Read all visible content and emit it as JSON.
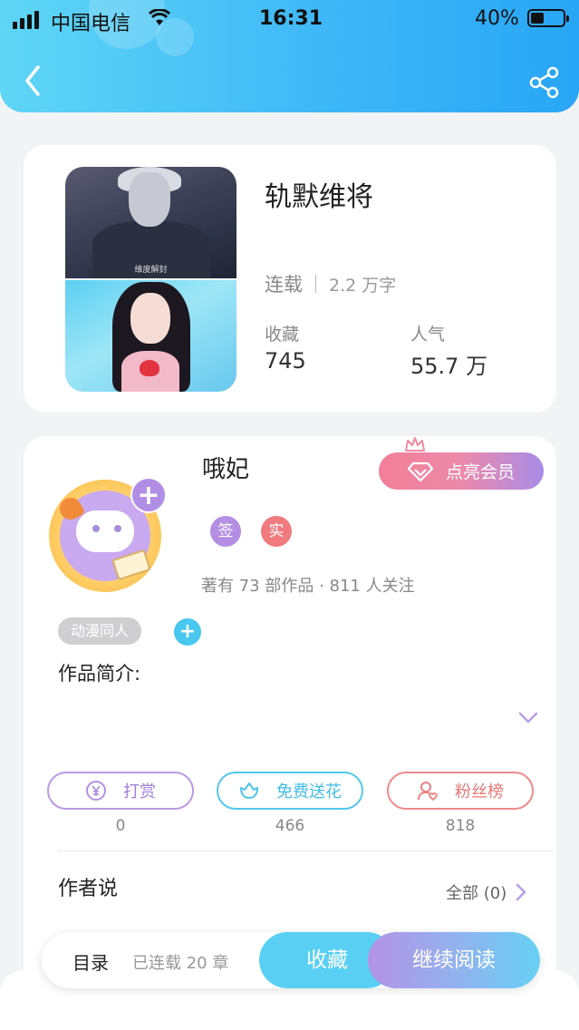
{
  "status_bar": {
    "carrier": "中国电信",
    "time": "16:31",
    "battery": "40%"
  },
  "header": {
    "back_icon": "chevron-left-icon",
    "share_icon": "share-icon"
  },
  "book": {
    "title": "轨默维将",
    "cover_caption": "维度解封",
    "status": "连载",
    "word_count": "2.2 万字",
    "favorites_label": "收藏",
    "favorites_value": "745",
    "popularity_label": "人气",
    "popularity_value": "55.7 万"
  },
  "author": {
    "name": "哦妃",
    "vip_button": "点亮会员",
    "badge_sign": "签",
    "badge_real": "实",
    "stats": "著有 73 部作品 · 811 人关注",
    "genre_tag": "动漫同人",
    "intro_label": "作品简介:"
  },
  "actions": [
    {
      "label": "打赏",
      "count": "0",
      "icon": "yen-icon"
    },
    {
      "label": "免费送花",
      "count": "466",
      "icon": "flower-icon"
    },
    {
      "label": "粉丝榜",
      "count": "818",
      "icon": "fan-user-icon"
    }
  ],
  "author_says": {
    "title": "作者说",
    "all_link": "全部 (0)"
  },
  "bottom_bar": {
    "toc": "目录",
    "toc_info": "已连载 20 章",
    "favorite": "收藏",
    "continue_reading": "继续阅读"
  },
  "colors": {
    "header_start": "#5fd6f5",
    "header_end": "#28a6f5",
    "accent_purple": "#b08ee6",
    "accent_cyan": "#48c7ef",
    "accent_red": "#ef8a8a"
  }
}
